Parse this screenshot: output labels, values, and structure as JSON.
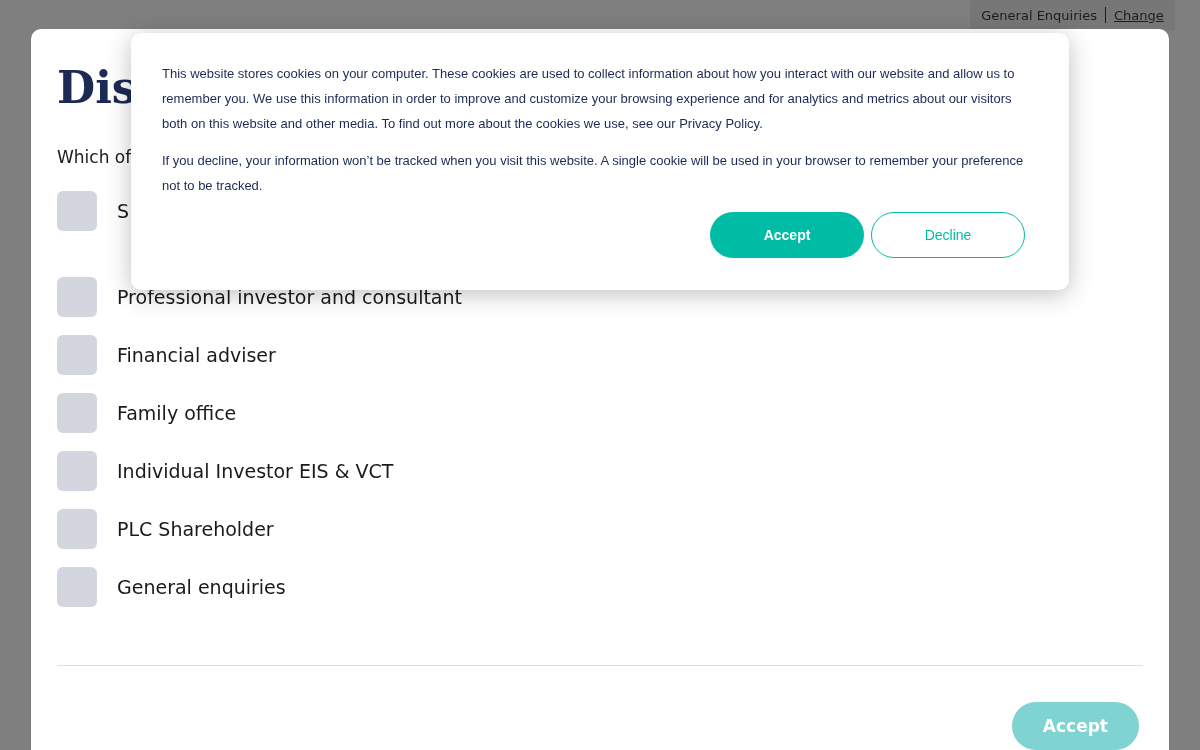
{
  "top_bar": {
    "audience": "General Enquiries",
    "change_link": "Change"
  },
  "modal": {
    "title": "Dis",
    "question": "Which of",
    "options": [
      {
        "label": "S",
        "checked": false
      },
      {
        "label": "Professional investor and consultant",
        "checked": false
      },
      {
        "label": "Financial adviser",
        "checked": false
      },
      {
        "label": "Family office",
        "checked": false
      },
      {
        "label": "Individual Investor EIS & VCT",
        "checked": false
      },
      {
        "label": "PLC Shareholder",
        "checked": false
      },
      {
        "label": "General enquiries",
        "checked": false
      }
    ],
    "accept_button": {
      "label": "Accept",
      "disabled": true
    }
  },
  "cookie_banner": {
    "paragraphs": [
      "This website stores cookies on your computer. These cookies are used to collect information about how you interact with our website and allow us to remember you. We use this information in order to improve and customize your browsing experience and for analytics and metrics about our visitors both on this website and other media. To find out more about the cookies we use, see our Privacy Policy.",
      "If you decline, your information won’t be tracked when you visit this website. A single cookie will be used in your browser to remember your preference not to be tracked."
    ],
    "accept": "Accept",
    "decline": "Decline"
  }
}
